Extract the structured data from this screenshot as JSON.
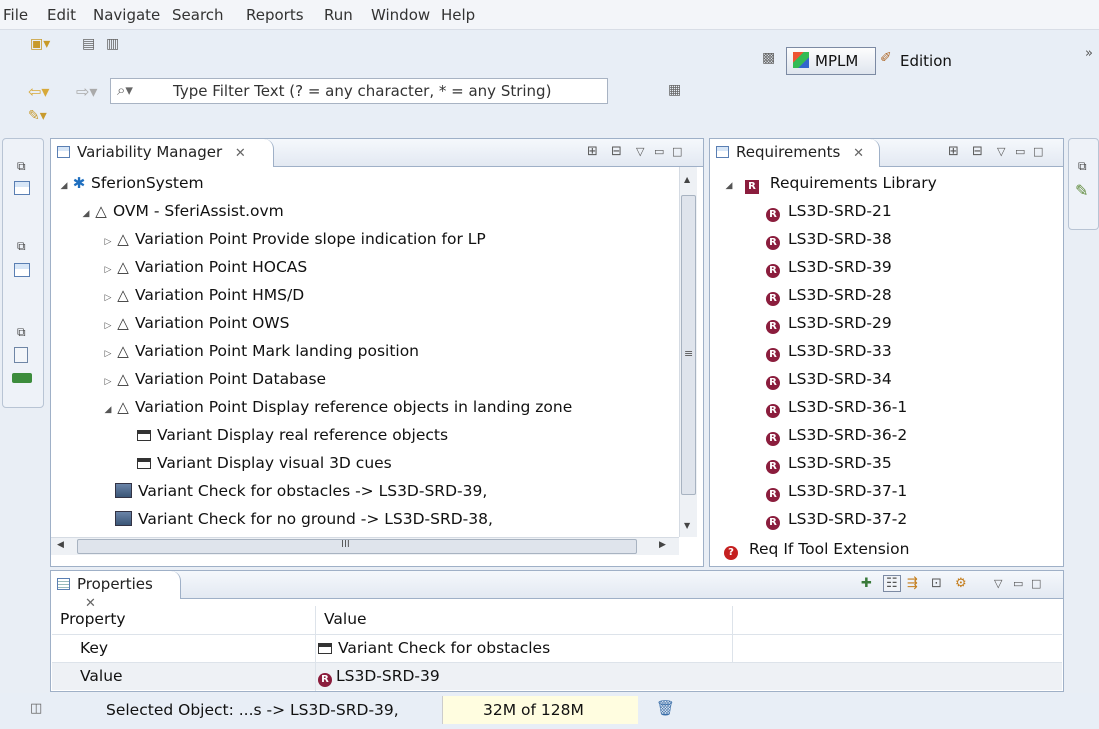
{
  "menu": [
    "File",
    "Edit",
    "Navigate",
    "Search",
    "Reports",
    "Run",
    "Window",
    "Help"
  ],
  "toolbar": {
    "filter_placeholder": "Type Filter Text (? = any character, * = any String)",
    "perspectives": [
      "MPLM",
      "Edition"
    ],
    "overflow": "»"
  },
  "variability": {
    "tab_label": "Variability Manager",
    "tree": [
      {
        "depth": 0,
        "toggle": "expanded",
        "icon": "snowflake-icon",
        "label": "SferionSystem"
      },
      {
        "depth": 1,
        "toggle": "expanded",
        "icon": "warning-triangle-icon",
        "label": "OVM - SferiAssist.ovm"
      },
      {
        "depth": 2,
        "toggle": "collapsed",
        "icon": "warning-triangle-icon",
        "label": "Variation Point Provide slope indication for LP"
      },
      {
        "depth": 2,
        "toggle": "collapsed",
        "icon": "warning-triangle-icon",
        "label": "Variation Point HOCAS"
      },
      {
        "depth": 2,
        "toggle": "collapsed",
        "icon": "warning-triangle-icon",
        "label": "Variation Point HMS/D"
      },
      {
        "depth": 2,
        "toggle": "collapsed",
        "icon": "warning-triangle-icon",
        "label": "Variation Point OWS"
      },
      {
        "depth": 2,
        "toggle": "collapsed",
        "icon": "warning-triangle-icon",
        "label": "Variation Point Mark landing position"
      },
      {
        "depth": 2,
        "toggle": "collapsed",
        "icon": "warning-triangle-icon",
        "label": "Variation Point Database"
      },
      {
        "depth": 2,
        "toggle": "expanded",
        "icon": "warning-triangle-icon",
        "label": "Variation Point Display reference objects in landing zone"
      },
      {
        "depth": 3,
        "toggle": "none",
        "icon": "variant-icon",
        "label": "Variant Display real reference objects"
      },
      {
        "depth": 3,
        "toggle": "none",
        "icon": "variant-icon",
        "label": "Variant Display visual 3D cues"
      },
      {
        "depth": 2,
        "toggle": "none",
        "icon": "variant-link-icon",
        "label": "Variant Check for obstacles -> LS3D-SRD-39,"
      },
      {
        "depth": 2,
        "toggle": "none",
        "icon": "variant-link-icon",
        "label": "Variant Check for no ground -> LS3D-SRD-38,"
      }
    ],
    "hscroll_grip": "III"
  },
  "requirements": {
    "tab_label": "Requirements",
    "library_label": "Requirements Library",
    "items": [
      "LS3D-SRD-21",
      "LS3D-SRD-38",
      "LS3D-SRD-39",
      "LS3D-SRD-28",
      "LS3D-SRD-29",
      "LS3D-SRD-33",
      "LS3D-SRD-34",
      "LS3D-SRD-36-1",
      "LS3D-SRD-36-2",
      "LS3D-SRD-35",
      "LS3D-SRD-37-1",
      "LS3D-SRD-37-2"
    ],
    "extension_label": "Req If Tool Extension"
  },
  "properties": {
    "tab_label": "Properties",
    "headers": [
      "Property",
      "Value"
    ],
    "rows": [
      {
        "property": "Key",
        "value": "Variant Check for obstacles"
      },
      {
        "property": "Value",
        "value": "LS3D-SRD-39"
      }
    ]
  },
  "status": {
    "selected": "Selected Object: ...s -> LS3D-SRD-39,",
    "memory": "32M of 128M"
  }
}
